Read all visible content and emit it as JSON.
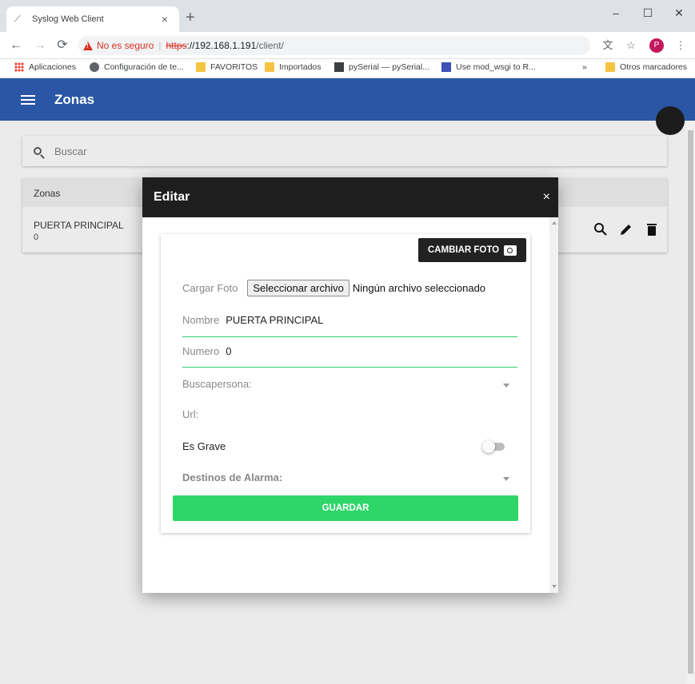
{
  "browser": {
    "tab_title": "Syslog Web Client",
    "tab_close": "×",
    "new_tab": "+",
    "window": {
      "minimize": "–",
      "maximize": "☐",
      "close": "✕"
    },
    "security_label": "No es seguro",
    "url_scheme": "https",
    "url_host": "://192.168.1.191",
    "url_path": "/client/",
    "profile_initial": "P",
    "bookmarks": [
      {
        "label": "Aplicaciones",
        "icon": "apps-icon"
      },
      {
        "label": "Configuración de te...",
        "icon": "globe-icon"
      },
      {
        "label": "FAVORITOS",
        "icon": "folder-icon"
      },
      {
        "label": "Importados",
        "icon": "folder-icon"
      },
      {
        "label": "pySerial — pySerial...",
        "icon": "book-icon"
      },
      {
        "label": "Use mod_wsgi to R...",
        "icon": "mod-icon"
      }
    ],
    "more_bookmarks": "»",
    "other_bookmarks": "Otros marcadores"
  },
  "app": {
    "title": "Zonas",
    "search_placeholder": "Buscar",
    "table_header": "Zonas",
    "rows": [
      {
        "name": "PUERTA PRINCIPAL",
        "number": "0"
      }
    ],
    "accent_color": "#2a56a5"
  },
  "dialog": {
    "title": "Editar",
    "close": "×",
    "change_photo_label": "CAMBIAR FOTO",
    "upload_label": "Cargar Foto",
    "file_button": "Seleccionar archivo",
    "file_status": "Ningún archivo seleccionado",
    "name_label": "Nombre",
    "name_value": "PUERTA PRINCIPAL",
    "number_label": "Numero",
    "number_value": "0",
    "pager_label": "Buscapersona:",
    "url_label": "Url:",
    "serious_label": "Es Grave",
    "serious_value": false,
    "alarm_label": "Destinos de Alarma:",
    "save_label": "GUARDAR",
    "save_color": "#2ed66a"
  }
}
